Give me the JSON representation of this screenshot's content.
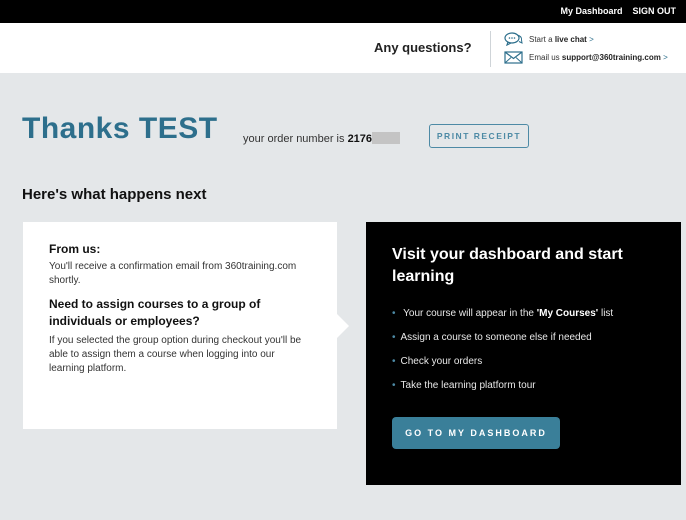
{
  "topbar": {
    "dashboard_link": "My Dashboard",
    "signout_link": "SIGN OUT"
  },
  "header": {
    "questions": "Any questions?",
    "chat_prefix": "Start a",
    "chat_link": "live chat",
    "email_prefix": "Email us",
    "email_address": "support@360training.com",
    "arrow": ">"
  },
  "confirmation": {
    "thanks": "Thanks TEST",
    "order_text": "your order number is",
    "order_number": "2176",
    "print_label": "PRINT RECEIPT"
  },
  "next_heading": "Here's what happens next",
  "from_us": {
    "title": "From us:",
    "text": "You'll receive a confirmation email from 360training.com shortly.",
    "group_title": "Need to assign courses to a group of individuals or employees?",
    "group_text": "If you selected the group option during checkout you'll be able to assign them a course when logging into our learning platform."
  },
  "dashboard_card": {
    "title": "Visit your dashboard and start learning",
    "item1_prefix": "Your course will appear in the",
    "item1_bold": "'My Courses'",
    "item1_suffix": "list",
    "item2": "Assign a course to someone else if needed",
    "item3": "Check your orders",
    "item4": "Take the learning platform tour",
    "button": "GO TO MY DASHBOARD"
  },
  "colors": {
    "accent": "#2d6f8c",
    "button": "#3a7f99",
    "background": "#e4e7e9",
    "dark_card": "#000000"
  },
  "icons": {
    "chat": "chat-bubbles-icon",
    "email": "envelope-icon"
  }
}
